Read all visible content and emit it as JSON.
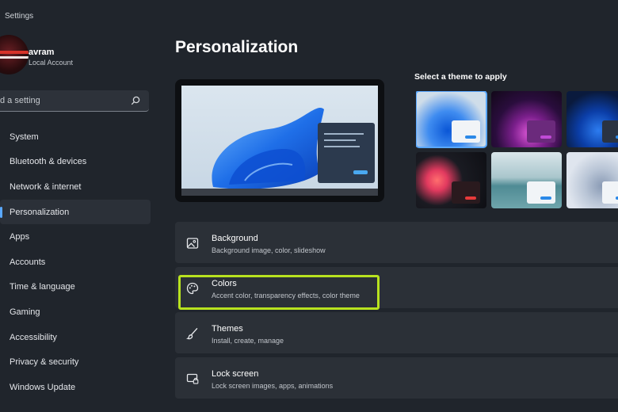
{
  "window": {
    "title": "Settings"
  },
  "user": {
    "name": "avram",
    "account_type": "Local Account"
  },
  "search": {
    "placeholder": "d a setting"
  },
  "nav": {
    "items": [
      {
        "label": "System",
        "active": false
      },
      {
        "label": "Bluetooth & devices",
        "active": false
      },
      {
        "label": "Network & internet",
        "active": false
      },
      {
        "label": "Personalization",
        "active": true
      },
      {
        "label": "Apps",
        "active": false
      },
      {
        "label": "Accounts",
        "active": false
      },
      {
        "label": "Time & language",
        "active": false
      },
      {
        "label": "Gaming",
        "active": false
      },
      {
        "label": "Accessibility",
        "active": false
      },
      {
        "label": "Privacy & security",
        "active": false
      },
      {
        "label": "Windows Update",
        "active": false
      }
    ]
  },
  "main": {
    "title": "Personalization",
    "themes": {
      "label": "Select a theme to apply",
      "items": [
        {
          "name": "windows-light-bloom",
          "selected": true
        },
        {
          "name": "windows-dark-glow",
          "selected": false
        },
        {
          "name": "windows-dark-bloom",
          "selected": false
        },
        {
          "name": "captured-motion",
          "selected": false
        },
        {
          "name": "sunrise-lake",
          "selected": false
        },
        {
          "name": "flow",
          "selected": false
        }
      ]
    },
    "settings": [
      {
        "icon": "image-icon",
        "title": "Background",
        "subtitle": "Background image, color, slideshow"
      },
      {
        "icon": "palette-icon",
        "title": "Colors",
        "subtitle": "Accent color, transparency effects, color theme",
        "highlighted": true
      },
      {
        "icon": "brush-icon",
        "title": "Themes",
        "subtitle": "Install, create, manage"
      },
      {
        "icon": "lock-screen-icon",
        "title": "Lock screen",
        "subtitle": "Lock screen images, apps, animations"
      }
    ]
  },
  "colors": {
    "accent": "#5aa8ff",
    "highlight_box": "#b8e21f",
    "background": "#20252c",
    "card": "#2b3037"
  }
}
